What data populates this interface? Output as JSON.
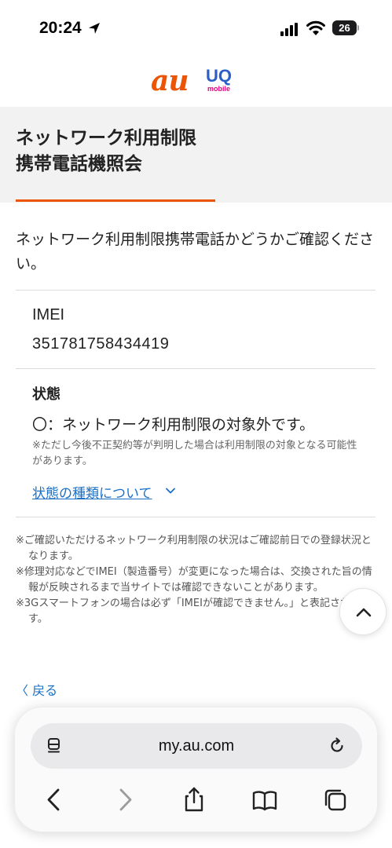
{
  "status_bar": {
    "time": "20:24",
    "battery": "26"
  },
  "brand": {
    "au": "au",
    "uq_main": "UQ",
    "uq_sub": "mobile"
  },
  "header": {
    "title_line1": "ネットワーク利用制限",
    "title_line2": "携帯電話機照会"
  },
  "intro": "ネットワーク利用制限携帯電話かどうかご確認ください。",
  "imei": {
    "label": "IMEI",
    "value": "351781758434419"
  },
  "status": {
    "label": "状態",
    "text": "〇：ネットワーク利用制限の対象外です。",
    "note": "※ただし今後不正契約等が判明した場合は利用制限の対象となる可能性があります。",
    "link": "状態の種類について"
  },
  "notes": [
    "※ご確認いただけるネットワーク利用制限の状況はご確認前日での登録状況となります。",
    "※修理対応などでIMEI（製造番号）が変更になった場合は、交換された旨の情報が反映されるまで当サイトでは確認できないことがあります。",
    "※3Gスマートフォンの場合は必ず「IMEIが確認できません。」と表記されます。"
  ],
  "back": "〈 戻る",
  "browser": {
    "url": "my.au.com"
  },
  "colors": {
    "accent": "#eb5505",
    "link": "#1a6fc6",
    "header_bg": "#f2f2f2"
  },
  "icons": [
    "location-arrow-icon",
    "cellular-signal-icon",
    "wifi-icon",
    "battery-icon",
    "chevron-down-icon",
    "chevron-up-icon",
    "reader-icon",
    "reload-icon",
    "back-arrow-icon",
    "forward-arrow-icon",
    "share-icon",
    "bookmarks-icon",
    "tabs-icon"
  ]
}
